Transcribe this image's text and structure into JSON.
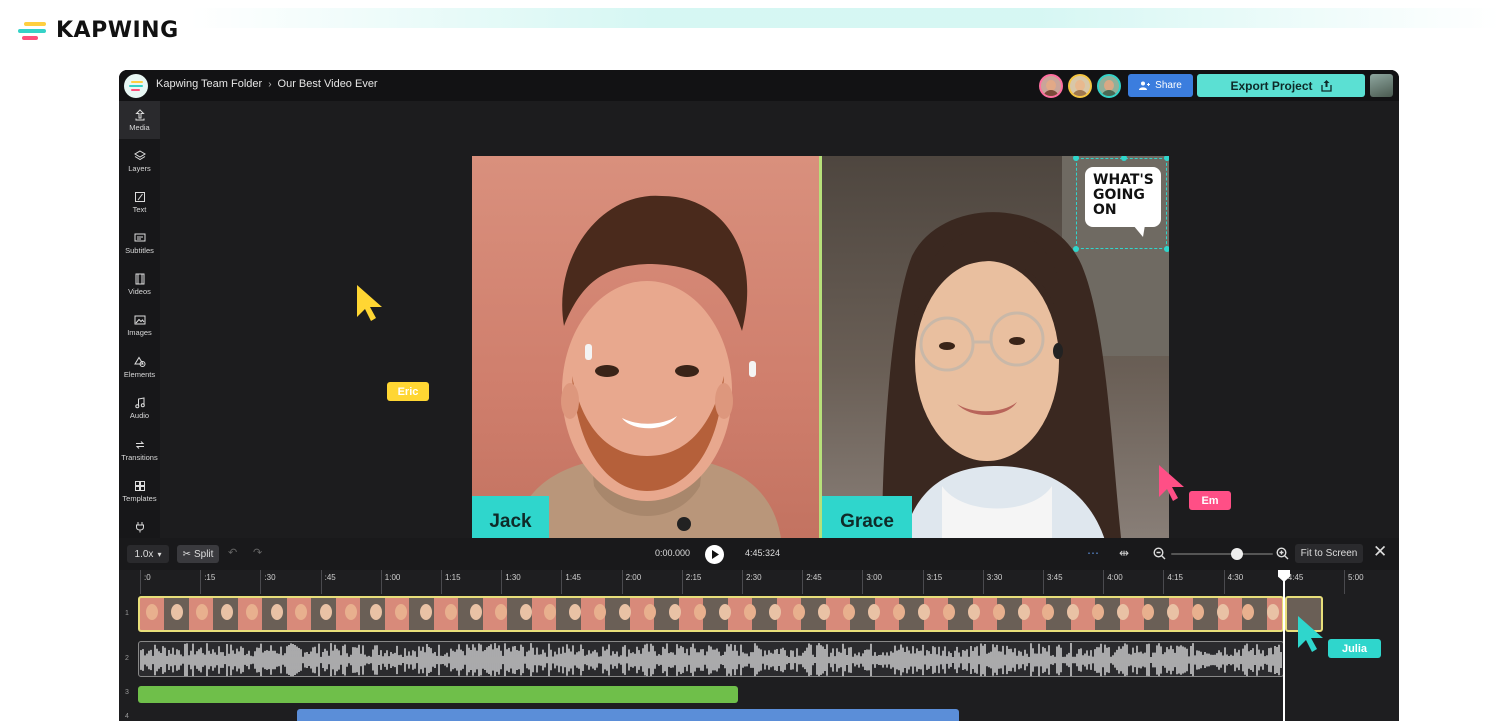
{
  "brand": {
    "name": "KAPWING"
  },
  "appbar": {
    "breadcrumb_folder": "Kapwing Team Folder",
    "breadcrumb_sep": "›",
    "breadcrumb_project": "Our Best Video Ever",
    "share_label": "Share",
    "export_label": "Export Project"
  },
  "sidebar": {
    "items": [
      {
        "label": "Media",
        "icon": "upload-icon"
      },
      {
        "label": "Layers",
        "icon": "layers-icon"
      },
      {
        "label": "Text",
        "icon": "text-icon"
      },
      {
        "label": "Subtitles",
        "icon": "subtitles-icon"
      },
      {
        "label": "Videos",
        "icon": "videos-icon"
      },
      {
        "label": "Images",
        "icon": "images-icon"
      },
      {
        "label": "Elements",
        "icon": "elements-icon"
      },
      {
        "label": "Audio",
        "icon": "audio-icon"
      },
      {
        "label": "Transitions",
        "icon": "transitions-icon"
      },
      {
        "label": "Templates",
        "icon": "templates-icon"
      }
    ]
  },
  "canvas": {
    "left_name": "Jack",
    "right_name": "Grace",
    "bubble_line1": "WHAT'S",
    "bubble_line2": "GOING",
    "bubble_line3": "ON"
  },
  "cursors": {
    "eric": {
      "label": "Eric",
      "color": "#ffd633"
    },
    "em": {
      "label": "Em",
      "color": "#ff4f86"
    },
    "julia": {
      "label": "Julia",
      "color": "#2fd6cc"
    }
  },
  "timeline": {
    "speed": "1.0x",
    "split_label": "Split",
    "current_time": "0:00.000",
    "total_time": "4:45:324",
    "fit_label": "Fit to Screen",
    "ruler": [
      ":0",
      ":15",
      ":30",
      ":45",
      "1:00",
      "1:15",
      "1:30",
      "1:45",
      "2:00",
      "2:15",
      "2:30",
      "2:45",
      "3:00",
      "3:15",
      "3:30",
      "3:45",
      "4:00",
      "4:15",
      "4:30",
      "4:45",
      "5:00"
    ],
    "track_numbers": [
      "1",
      "2",
      "3",
      "4"
    ]
  },
  "colors": {
    "accent_teal": "#5be0d3",
    "share_blue": "#3b7dde",
    "clip_green": "#6fbf4a",
    "clip_blue": "#5b8ed8"
  }
}
